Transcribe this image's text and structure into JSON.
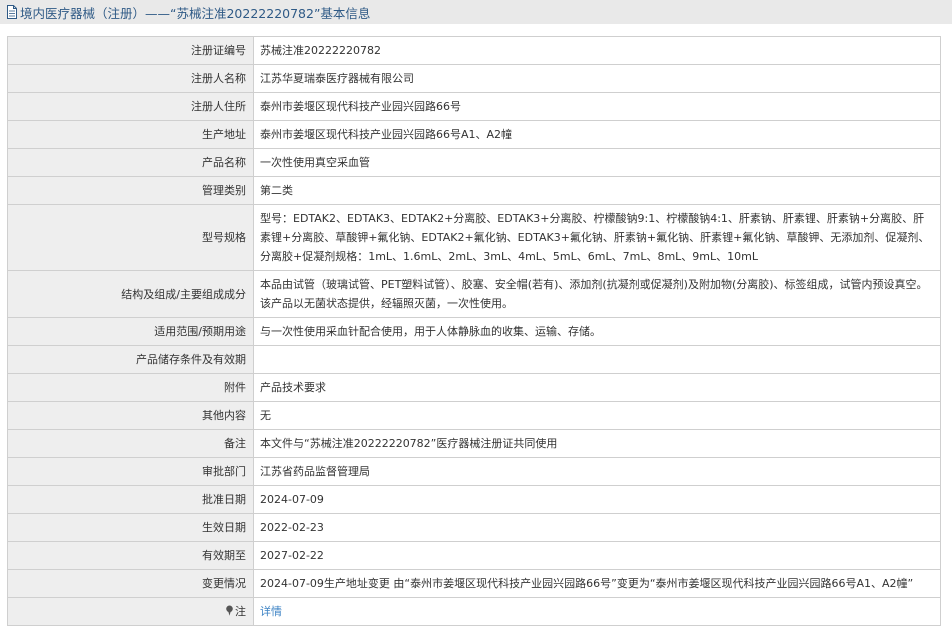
{
  "header": {
    "icon": "document-icon",
    "title": "境内医疗器械（注册）——“苏械注准20222220782”基本信息"
  },
  "rows": [
    {
      "key": "reg_no",
      "label": "注册证编号",
      "value": "苏械注准20222220782"
    },
    {
      "key": "registrant",
      "label": "注册人名称",
      "value": "江苏华夏瑞泰医疗器械有限公司"
    },
    {
      "key": "residence",
      "label": "注册人住所",
      "value": "泰州市姜堰区现代科技产业园兴园路66号"
    },
    {
      "key": "production_address",
      "label": "生产地址",
      "value": "泰州市姜堰区现代科技产业园兴园路66号A1、A2幢"
    },
    {
      "key": "product_name",
      "label": "产品名称",
      "value": "一次性使用真空采血管"
    },
    {
      "key": "category",
      "label": "管理类别",
      "value": "第二类"
    },
    {
      "key": "model",
      "label": "型号规格",
      "value": "型号：EDTAK2、EDTAK3、EDTAK2+分离胶、EDTAK3+分离胶、柠檬酸钠9:1、柠檬酸钠4:1、肝素钠、肝素锂、肝素钠+分离胶、肝素锂+分离胶、草酸钾+氟化钠、EDTAK2+氟化钠、EDTAK3+氟化钠、肝素钠+氟化钠、肝素锂+氟化钠、草酸钾、无添加剂、促凝剂、分离胶+促凝剂规格：1mL、1.6mL、2mL、3mL、4mL、5mL、6mL、7mL、8mL、9mL、10mL"
    },
    {
      "key": "composition",
      "label": "结构及组成/主要组成成分",
      "value": "本品由试管（玻璃试管、PET塑料试管）、胶塞、安全帽(若有)、添加剂(抗凝剂或促凝剂)及附加物(分离胶)、标签组成，试管内预设真空。该产品以无菌状态提供，经辐照灭菌，一次性使用。"
    },
    {
      "key": "scope",
      "label": "适用范围/预期用途",
      "value": "与一次性使用采血针配合使用，用于人体静脉血的收集、运输、存储。"
    },
    {
      "key": "storage",
      "label": "产品储存条件及有效期",
      "value": ""
    },
    {
      "key": "attachment",
      "label": "附件",
      "value": "产品技术要求"
    },
    {
      "key": "other",
      "label": "其他内容",
      "value": "无"
    },
    {
      "key": "remark",
      "label": "备注",
      "value": "本文件与“苏械注准20222220782”医疗器械注册证共同使用"
    },
    {
      "key": "approval_dept",
      "label": "审批部门",
      "value": "江苏省药品监督管理局"
    },
    {
      "key": "approval_date",
      "label": "批准日期",
      "value": "2024-07-09"
    },
    {
      "key": "effective_date",
      "label": "生效日期",
      "value": "2022-02-23"
    },
    {
      "key": "expiry_date",
      "label": "有效期至",
      "value": "2027-02-22"
    },
    {
      "key": "changes",
      "label": "变更情况",
      "value": "2024-07-09生产地址变更 由“泰州市姜堰区现代科技产业园兴园路66号”变更为“泰州市姜堰区现代科技产业园兴园路66号A1、A2幢”"
    }
  ],
  "note_row": {
    "icon": "pin-icon",
    "label": "注",
    "link_text": "详情"
  }
}
